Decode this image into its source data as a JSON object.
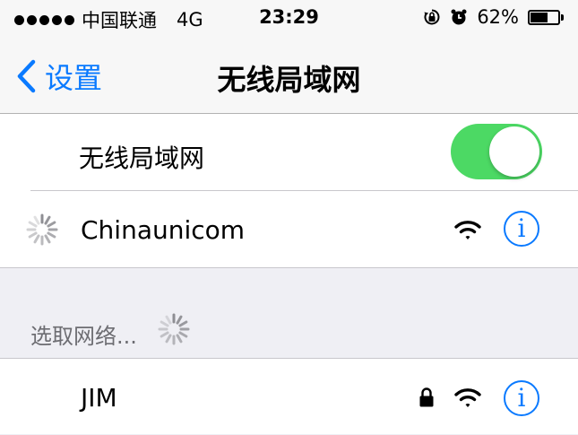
{
  "status_bar": {
    "carrier": "中国联通",
    "network": "4G",
    "time": "23:29",
    "battery_percent": "62%",
    "battery_level": 0.62,
    "icons": [
      "signal-dots-icon",
      "rotation-lock-icon",
      "alarm-icon",
      "battery-icon"
    ]
  },
  "nav": {
    "back_label": "设置",
    "title": "无线局域网"
  },
  "wifi_toggle": {
    "label": "无线局域网",
    "on": true
  },
  "connected_network": {
    "name": "Chinaunicom"
  },
  "section": {
    "choose_label": "选取网络..."
  },
  "networks": [
    {
      "name": "JIM",
      "locked": true
    }
  ],
  "colors": {
    "accent": "#0a7aff",
    "toggle_on": "#4cd964"
  }
}
